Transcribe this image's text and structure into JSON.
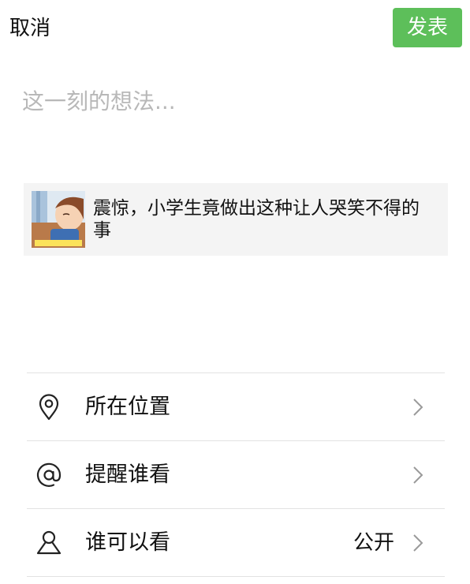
{
  "header": {
    "cancel_label": "取消",
    "publish_label": "发表"
  },
  "composer": {
    "placeholder": "这一刻的想法...",
    "value": ""
  },
  "share_card": {
    "title": "震惊，小学生竟做出这种让人哭笑不得的事"
  },
  "menu": {
    "items": [
      {
        "label": "所在位置",
        "icon": "location-pin-icon",
        "value": ""
      },
      {
        "label": "提醒谁看",
        "icon": "at-sign-icon",
        "value": ""
      },
      {
        "label": "谁可以看",
        "icon": "person-icon",
        "value": "公开"
      }
    ]
  },
  "colors": {
    "publish_button": "#5dbf5a",
    "placeholder": "#b8b8b8",
    "card_background": "#f4f4f4",
    "divider": "#e2e2e2"
  }
}
